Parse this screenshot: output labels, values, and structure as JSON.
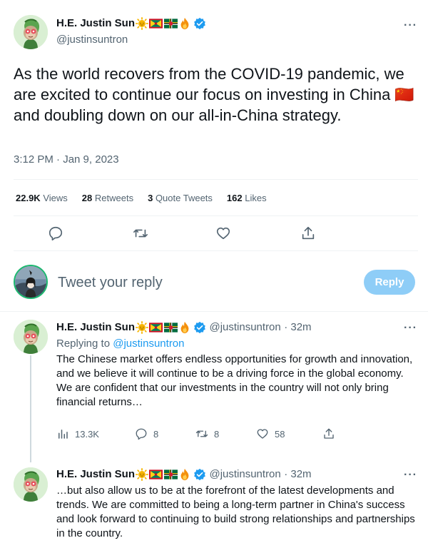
{
  "main_tweet": {
    "author_name": "H.E. Justin Sun",
    "author_handle": "@justinsuntron",
    "text": "As the world recovers from the COVID-19 pandemic, we are excited to continue our focus on investing in China 🇨🇳 and doubling down on our all-in-China strategy.",
    "timestamp": "3:12 PM · Jan 9, 2023",
    "stats": {
      "views_count": "22.9K",
      "views_label": "Views",
      "retweets_count": "28",
      "retweets_label": "Retweets",
      "quotes_count": "3",
      "quotes_label": "Quote Tweets",
      "likes_count": "162",
      "likes_label": "Likes"
    }
  },
  "composer": {
    "placeholder": "Tweet your reply",
    "button_label": "Reply"
  },
  "replies": [
    {
      "author_name": "H.E. Justin Sun",
      "author_handle": "@justinsuntron",
      "time": "· 32m",
      "replying_prefix": "Replying to",
      "replying_handle": "@justinsuntron",
      "text": "The Chinese market offers endless opportunities for growth and innovation, and we believe it will continue to be a driving force in the global economy. We are confident that our investments in the country will not only bring financial returns…",
      "views": "13.3K",
      "replies": "8",
      "retweets": "8",
      "likes": "58"
    },
    {
      "author_name": "H.E. Justin Sun",
      "author_handle": "@justinsuntron",
      "time": "· 32m",
      "text": "…but also allow us to be at the forefront of the latest developments and trends. We are committed to being a long-term partner in China's success and look forward to continuing to build strong relationships and partnerships in the country."
    }
  ],
  "colors": {
    "accent": "#1d9bf0",
    "reply_button": "#8ecdf7",
    "secondary_text": "#536471"
  }
}
